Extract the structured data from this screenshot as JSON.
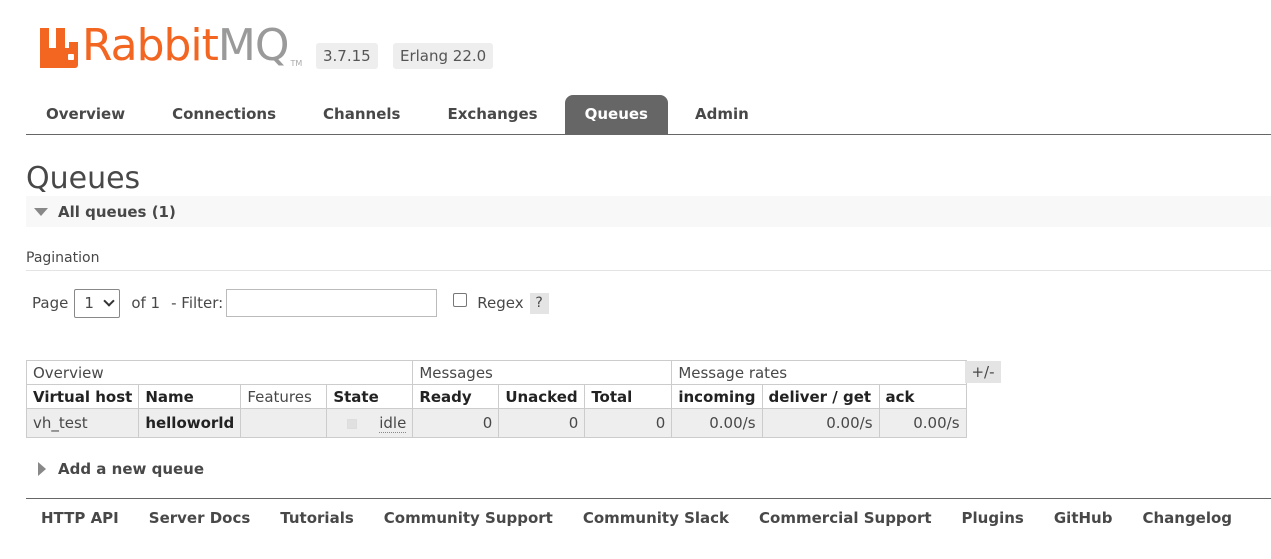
{
  "header": {
    "logo_text_primary": "Rabbit",
    "logo_text_secondary": "MQ",
    "logo_tm": "TM",
    "version": "3.7.15",
    "erlang": "Erlang 22.0",
    "brand_color": "#f26622"
  },
  "tabs": [
    {
      "label": "Overview",
      "active": false
    },
    {
      "label": "Connections",
      "active": false
    },
    {
      "label": "Channels",
      "active": false
    },
    {
      "label": "Exchanges",
      "active": false
    },
    {
      "label": "Queues",
      "active": true
    },
    {
      "label": "Admin",
      "active": false
    }
  ],
  "page": {
    "title": "Queues",
    "section_title": "All queues (1)"
  },
  "pagination": {
    "label": "Pagination",
    "page_label": "Page",
    "page_value": "1",
    "of_label": "of 1",
    "filter_label": "- Filter:",
    "filter_value": "",
    "regex_label": "Regex",
    "help": "?"
  },
  "table": {
    "groups": [
      "Overview",
      "Messages",
      "Message rates"
    ],
    "columns": [
      "Virtual host",
      "Name",
      "Features",
      "State",
      "Ready",
      "Unacked",
      "Total",
      "incoming",
      "deliver / get",
      "ack"
    ],
    "rows": [
      {
        "virtual_host": "vh_test",
        "name": "helloworld",
        "features": "",
        "state": "idle",
        "ready": "0",
        "unacked": "0",
        "total": "0",
        "incoming": "0.00/s",
        "deliver_get": "0.00/s",
        "ack": "0.00/s"
      }
    ],
    "toggle": "+/-"
  },
  "add_queue": "Add a new queue",
  "footer": [
    "HTTP API",
    "Server Docs",
    "Tutorials",
    "Community Support",
    "Community Slack",
    "Commercial Support",
    "Plugins",
    "GitHub",
    "Changelog"
  ]
}
